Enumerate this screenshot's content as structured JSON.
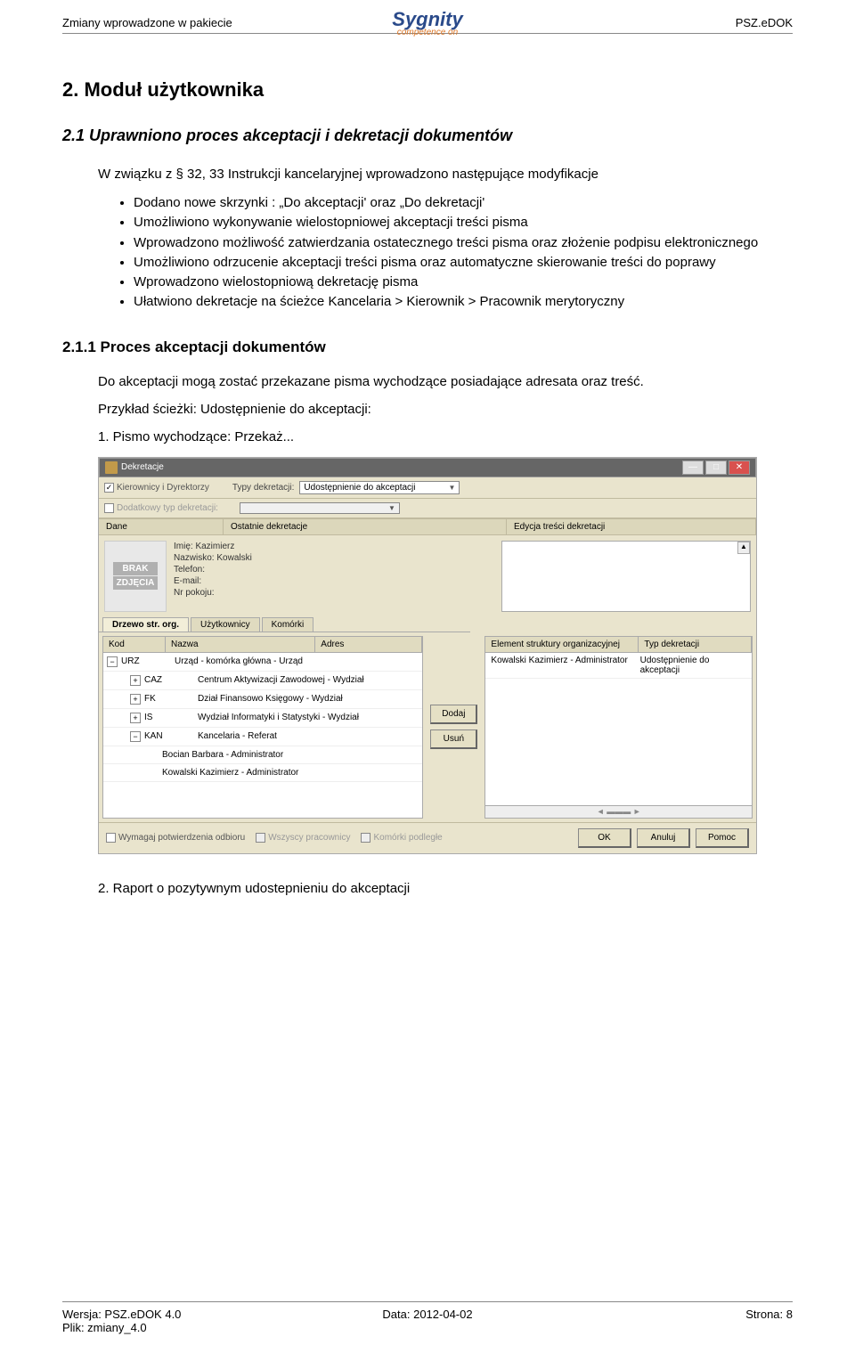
{
  "header": {
    "left": "Zmiany wprowadzone w pakiecie",
    "brand": "Sygnity",
    "brand_sub": "competence on",
    "right": "PSZ.eDOK"
  },
  "h1": "2.   Moduł  użytkownika",
  "h2": "2.1   Uprawniono proces akceptacji i dekretacji dokumentów",
  "intro": "W związku z § 32, 33 Instrukcji kancelaryjnej wprowadzono następujące modyfikacje",
  "bullets": [
    "Dodano nowe skrzynki : „Do akceptacji' oraz „Do dekretacji'",
    "Umożliwiono wykonywanie wielostopniowej akceptacji treści pisma",
    "Wprowadzono możliwość zatwierdzania ostatecznego treści pisma oraz złożenie podpisu elektronicznego",
    "Umożliwiono odrzucenie akceptacji treści pisma oraz automatyczne skierowanie treści do poprawy",
    "Wprowadzono wielostopniową dekretację pisma",
    "Ułatwiono dekretacje na ścieżce Kancelaria > Kierownik > Pracownik merytoryczny"
  ],
  "h3": "2.1.1     Proces akceptacji dokumentów",
  "p1": "Do akceptacji mogą zostać przekazane pisma wychodzące posiadające adresata oraz treść.",
  "p2": "Przykład ścieżki: Udostępnienie do akceptacji:",
  "p3": "1. Pismo wychodzące: Przekaż...",
  "p4": "2. Raport o pozytywnym udostepnieniu do akceptacji",
  "app": {
    "title": "Dekretacje",
    "chk_kierownicy": "Kierownicy i Dyrektorzy",
    "lbl_typy": "Typy dekretacji:",
    "sel_typy": "Udostępnienie do akceptacji",
    "chk_dodatkowy": "Dodatkowy typ dekretacji:",
    "pane_dane": "Dane",
    "pane_ostatnie": "Ostatnie dekretacje",
    "pane_edycja": "Edycja treści dekretacji",
    "info_imie_lbl": "Imię:",
    "info_imie": "Kazimierz",
    "info_nazwisko_lbl": "Nazwisko:",
    "info_nazwisko": "Kowalski",
    "info_telefon": "Telefon:",
    "info_email": "E-mail:",
    "info_pokoj": "Nr pokoju:",
    "photo_brak": "BRAK",
    "photo_zdjecia": "ZDJĘCIA",
    "tab1": "Drzewo str. org.",
    "tab2": "Użytkownicy",
    "tab3": "Komórki",
    "col_kod": "Kod",
    "col_nazwa": "Nazwa",
    "col_adres": "Adres",
    "tree": [
      {
        "exp": "−",
        "kod": "URZ",
        "nazwa": "Urząd - komórka główna - Urząd"
      },
      {
        "exp": "+",
        "kod": "CAZ",
        "nazwa": "Centrum Aktywizacji Zawodowej - Wydział"
      },
      {
        "exp": "+",
        "kod": "FK",
        "nazwa": "Dział Finansowo Księgowy - Wydział"
      },
      {
        "exp": "+",
        "kod": "IS",
        "nazwa": "Wydział Informatyki i Statystyki - Wydział"
      },
      {
        "exp": "−",
        "kod": "KAN",
        "nazwa": "Kancelaria - Referat"
      }
    ],
    "tree_children": [
      "Bocian Barbara - Administrator",
      "Kowalski Kazimierz - Administrator"
    ],
    "btn_dodaj": "Dodaj",
    "btn_usun": "Usuń",
    "rcol1": "Element struktury organizacyjnej",
    "rcol2": "Typ dekretacji",
    "rrow_name": "Kowalski Kazimierz - Administrator",
    "rrow_type": "Udostępnienie do akceptacji",
    "chk_wymagaj": "Wymagaj potwierdzenia odbioru",
    "chk_wszyscy": "Wszyscy pracownicy",
    "chk_podlegle": "Komórki podległe",
    "btn_ok": "OK",
    "btn_anuluj": "Anuluj",
    "btn_pomoc": "Pomoc"
  },
  "footer": {
    "version": "Wersja: PSZ.eDOK 4.0",
    "file": "Plik: zmiany_4.0",
    "date": "Data: 2012-04-02",
    "page": "Strona: 8"
  }
}
